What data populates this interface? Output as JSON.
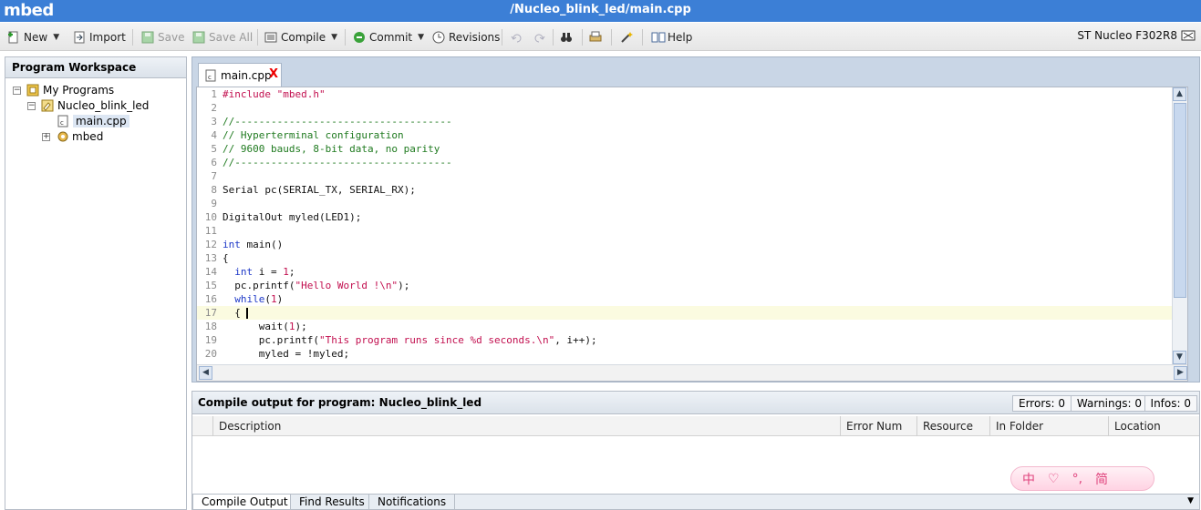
{
  "app": {
    "brand": "mbed",
    "file_path": "/Nucleo_blink_led/main.cpp"
  },
  "toolbar": {
    "new_label": "New",
    "import_label": "Import",
    "save_label": "Save",
    "save_all_label": "Save All",
    "compile_label": "Compile",
    "commit_label": "Commit",
    "revisions_label": "Revisions",
    "help_label": "Help",
    "device": "ST Nucleo F302R8"
  },
  "workspace": {
    "title": "Program Workspace",
    "tree": {
      "root": "My Programs",
      "program": "Nucleo_blink_led",
      "file": "main.cpp",
      "library": "mbed"
    }
  },
  "editor": {
    "tab_label": "main.cpp",
    "tab_close": "X",
    "active_line": 17,
    "lines": [
      {
        "n": "1",
        "t": "#include \"mbed.h\""
      },
      {
        "n": "2",
        "t": ""
      },
      {
        "n": "3",
        "t": "//------------------------------------"
      },
      {
        "n": "4",
        "t": "// Hyperterminal configuration"
      },
      {
        "n": "5",
        "t": "// 9600 bauds, 8-bit data, no parity"
      },
      {
        "n": "6",
        "t": "//------------------------------------"
      },
      {
        "n": "7",
        "t": ""
      },
      {
        "n": "8",
        "t": "Serial pc(SERIAL_TX, SERIAL_RX);"
      },
      {
        "n": "9",
        "t": ""
      },
      {
        "n": "10",
        "t": "DigitalOut myled(LED1);"
      },
      {
        "n": "11",
        "t": ""
      },
      {
        "n": "12",
        "t": "int main()"
      },
      {
        "n": "13",
        "t": "{"
      },
      {
        "n": "14",
        "t": "  int i = 1;"
      },
      {
        "n": "15",
        "t": "  pc.printf(\"Hello World !\\n\");"
      },
      {
        "n": "16",
        "t": "  while(1)"
      },
      {
        "n": "17",
        "t": "  {"
      },
      {
        "n": "18",
        "t": "      wait(1);"
      },
      {
        "n": "19",
        "t": "      pc.printf(\"This program runs since %d seconds.\\n\", i++);"
      },
      {
        "n": "20",
        "t": "      myled = !myled;"
      }
    ]
  },
  "compile_output": {
    "title": "Compile output for program: Nucleo_blink_led",
    "errors": "Errors: 0",
    "warnings": "Warnings: 0",
    "infos": "Infos: 0",
    "columns": [
      "Description",
      "Error Num",
      "Resource",
      "In Folder",
      "Location"
    ],
    "tabs": [
      "Compile Output",
      "Find Results",
      "Notifications"
    ]
  },
  "ime": {
    "chars": [
      "中",
      "♡",
      "°,",
      "简"
    ]
  }
}
